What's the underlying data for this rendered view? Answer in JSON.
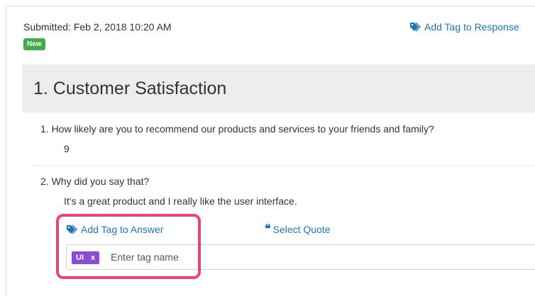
{
  "response": {
    "submitted_text": "Submitted: Feb 2, 2018 10:20 AM",
    "status_badge": "New",
    "add_tag_response_label": "Add Tag to Response"
  },
  "section": {
    "title": "1. Customer Satisfaction"
  },
  "questions": [
    {
      "text": "1. How likely are you to recommend our products and services to your friends and family?",
      "answer": "9"
    },
    {
      "text": "2. Why did you say that?",
      "answer": "It's a great product and I really like the user interface."
    }
  ],
  "answer_actions": {
    "add_tag_label": "Add Tag to Answer",
    "select_quote_label": "Select Quote"
  },
  "tag_field": {
    "chips": [
      {
        "label": "UI",
        "remove": "x"
      }
    ],
    "placeholder": "Enter tag name"
  },
  "colors": {
    "link": "#1b75bb",
    "badge_new": "#3fae49",
    "chip": "#8a4bd6",
    "highlight": "#e8437a",
    "section_bg": "#ededed"
  },
  "icons": {
    "tag": "tag-icon",
    "quote": "quote-icon"
  }
}
